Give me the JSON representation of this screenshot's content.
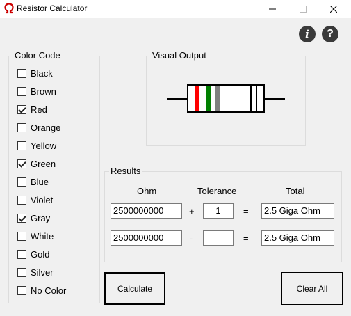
{
  "window": {
    "title": "Resistor Calculator",
    "icon": "omega-icon",
    "accent_color": "#cc0000"
  },
  "header_buttons": {
    "info_glyph": "i",
    "help_glyph": "?"
  },
  "color_code": {
    "label": "Color Code",
    "items": [
      {
        "label": "Black",
        "checked": false
      },
      {
        "label": "Brown",
        "checked": false
      },
      {
        "label": "Red",
        "checked": true
      },
      {
        "label": "Orange",
        "checked": false
      },
      {
        "label": "Yellow",
        "checked": false
      },
      {
        "label": "Green",
        "checked": true
      },
      {
        "label": "Blue",
        "checked": false
      },
      {
        "label": "Violet",
        "checked": false
      },
      {
        "label": "Gray",
        "checked": true
      },
      {
        "label": "White",
        "checked": false
      },
      {
        "label": "Gold",
        "checked": false
      },
      {
        "label": "Silver",
        "checked": false
      },
      {
        "label": "No Color",
        "checked": false
      }
    ]
  },
  "visual_output": {
    "label": "Visual Output",
    "band_colors": [
      "#ff0000",
      "#008000",
      "#808080"
    ]
  },
  "results": {
    "label": "Results",
    "headers": {
      "ohm": "Ohm",
      "tolerance": "Tolerance",
      "total": "Total"
    },
    "row1": {
      "ohm": "2500000000",
      "operator": "+",
      "tolerance": "1",
      "equals": "=",
      "total": "2.5 Giga Ohm"
    },
    "row2": {
      "ohm": "2500000000",
      "operator": "-",
      "tolerance": "",
      "equals": "=",
      "total": "2.5 Giga Ohm"
    }
  },
  "buttons": {
    "calculate": "Calculate",
    "clear_all": "Clear All"
  }
}
